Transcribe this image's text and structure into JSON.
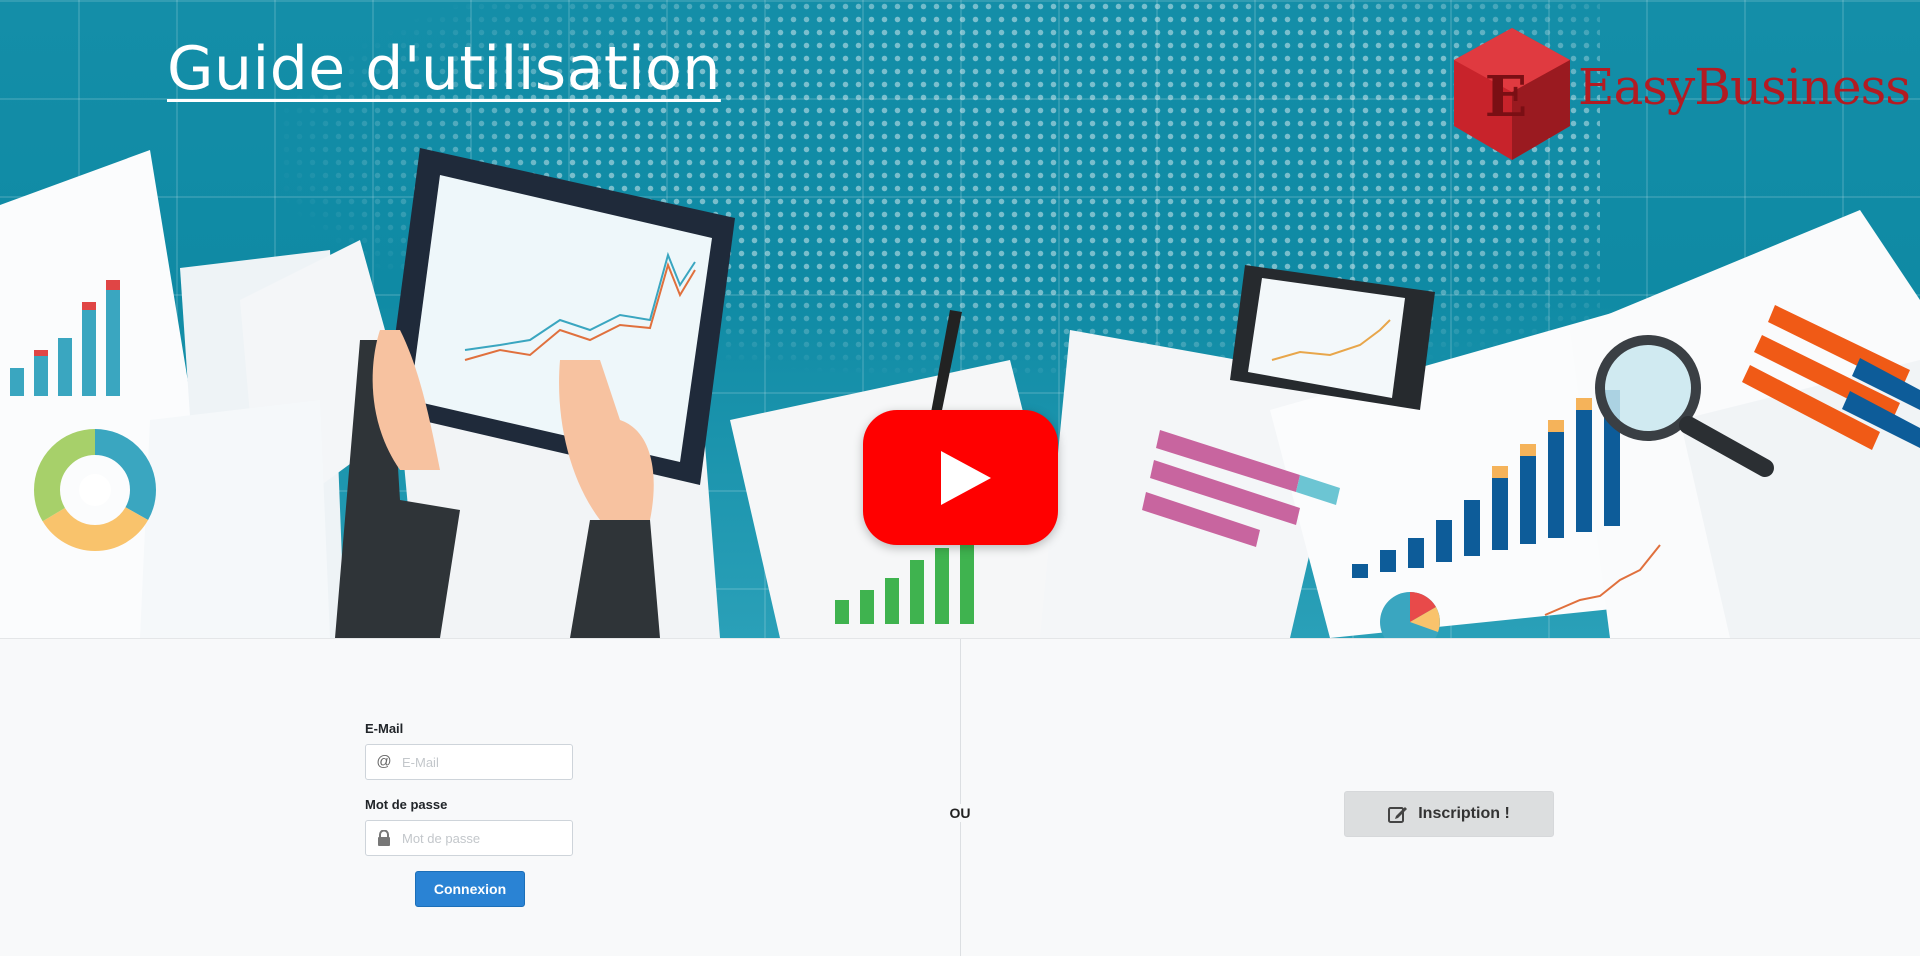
{
  "hero": {
    "title": "Guide d'utilisation",
    "brand": {
      "logo_letter": "E",
      "name": "EasyBusiness"
    },
    "video_button": {
      "icon": "youtube-play-icon"
    }
  },
  "login": {
    "email": {
      "label": "E-Mail",
      "placeholder": "E-Mail",
      "value": "",
      "icon": "at-icon"
    },
    "password": {
      "label": "Mot de passe",
      "placeholder": "Mot de passe",
      "value": "",
      "icon": "lock-icon"
    },
    "submit_label": "Connexion"
  },
  "separator": "OU",
  "register": {
    "label": "Inscription !",
    "icon": "edit-icon"
  },
  "colors": {
    "hero_bg": "#148ea8",
    "brand_red": "#b31b22",
    "youtube_red": "#ff0000",
    "primary_button": "#2a83d4",
    "panel_bg": "#f8f9fa"
  }
}
